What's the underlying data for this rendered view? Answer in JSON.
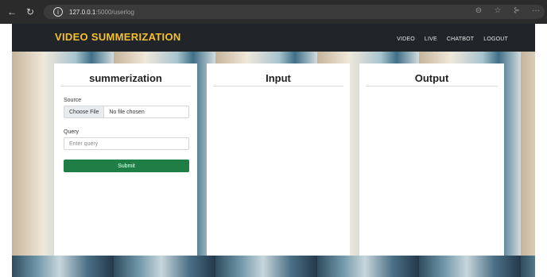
{
  "browser": {
    "back_icon": "←",
    "reload_icon": "↻",
    "info_icon": "i",
    "url_host": "127.0.0.1",
    "url_path": ":5000/userlog",
    "zoom_icon": "⊖",
    "favorite_icon": "☆",
    "favorites_bar_icon": "⊱",
    "more_icon": "···"
  },
  "navbar": {
    "brand": "VIDEO SUMMERIZATION",
    "links": [
      "VIDEO",
      "LIVE",
      "CHATBOT",
      "LOGOUT"
    ]
  },
  "summerization_card": {
    "title": "summerization",
    "source_label": "Source",
    "file_button_label": "Choose File",
    "file_status": "No file chosen",
    "query_label": "Query",
    "query_placeholder": "Enter query",
    "submit_label": "Submit"
  },
  "input_card": {
    "title": "Input"
  },
  "output_card": {
    "title": "Output"
  },
  "colors": {
    "navbar_bg": "#212529",
    "brand_color": "#f3c02d",
    "submit_bg": "#1f7d46"
  }
}
